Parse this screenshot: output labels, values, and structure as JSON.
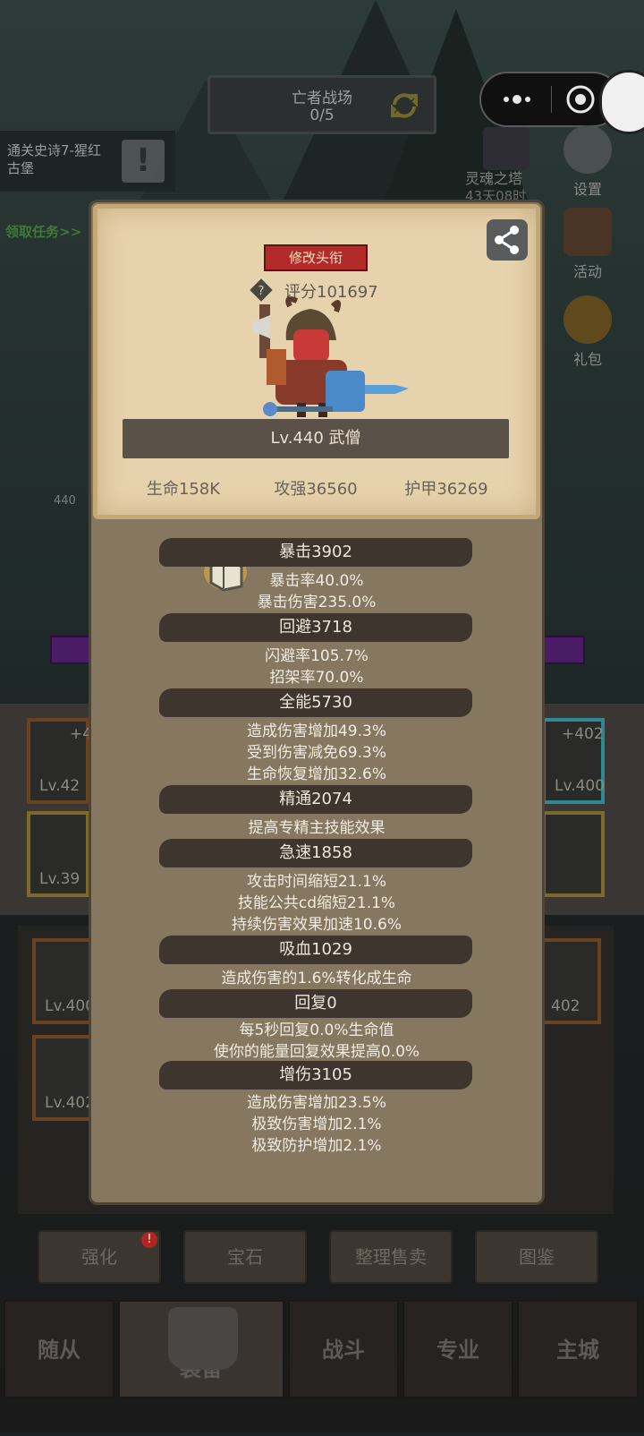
{
  "hud": {
    "arena_title": "亡者战场",
    "arena_count": "0/5",
    "quest_text": "通关史诗7-猩红古堡",
    "quest_badge": "!",
    "get_quest": "领取任务>>",
    "tower": "灵魂之塔",
    "tower_timer": "43天08时",
    "side_buttons": [
      "设置",
      "活动",
      "礼包"
    ],
    "bg_level": "440"
  },
  "bg_slots": {
    "left_top_bonus": "+4",
    "left_top_level": "Lv.42",
    "left_mid_level": "Lv.39",
    "left_low1_level": "Lv.400",
    "left_low2_level": "Lv.402",
    "right_top_bonus": "+402",
    "right_top_level": "Lv.400",
    "right_low_level": "402"
  },
  "function_buttons": [
    "强化",
    "宝石",
    "整理售卖",
    "图鉴"
  ],
  "nav_tabs": [
    "随从",
    "装备",
    "战斗",
    "专业",
    "主城"
  ],
  "card": {
    "title_button": "修改头衔",
    "score": "评分101697",
    "level_class": "Lv.440 武僧",
    "hp": "生命158K",
    "attack": "攻强36560",
    "armor": "护甲36269"
  },
  "stats": [
    {
      "header": "暴击3902",
      "lines": [
        "暴击率40.0%",
        "暴击伤害235.0%"
      ]
    },
    {
      "header": "回避3718",
      "lines": [
        "闪避率105.7%",
        "招架率70.0%"
      ]
    },
    {
      "header": "全能5730",
      "lines": [
        "造成伤害增加49.3%",
        "受到伤害减免69.3%",
        "生命恢复增加32.6%"
      ]
    },
    {
      "header": "精通2074",
      "lines": [
        "提高专精主技能效果"
      ]
    },
    {
      "header": "急速1858",
      "lines": [
        "攻击时间缩短21.1%",
        "技能公共cd缩短21.1%",
        "持续伤害效果加速10.6%"
      ]
    },
    {
      "header": "吸血1029",
      "lines": [
        "造成伤害的1.6%转化成生命"
      ]
    },
    {
      "header": "回复0",
      "lines": [
        "每5秒回复0.0%生命值",
        "使你的能量回复效果提高0.0%"
      ]
    },
    {
      "header": "增伤3105",
      "lines": [
        "造成伤害增加23.5%",
        "极致伤害增加2.1%",
        "极致防护增加2.1%"
      ]
    }
  ],
  "colors": {
    "panel": "#857760",
    "card": "#e6d2ac",
    "title_button": "#b22a2a",
    "header_bar": "#3d352e"
  }
}
